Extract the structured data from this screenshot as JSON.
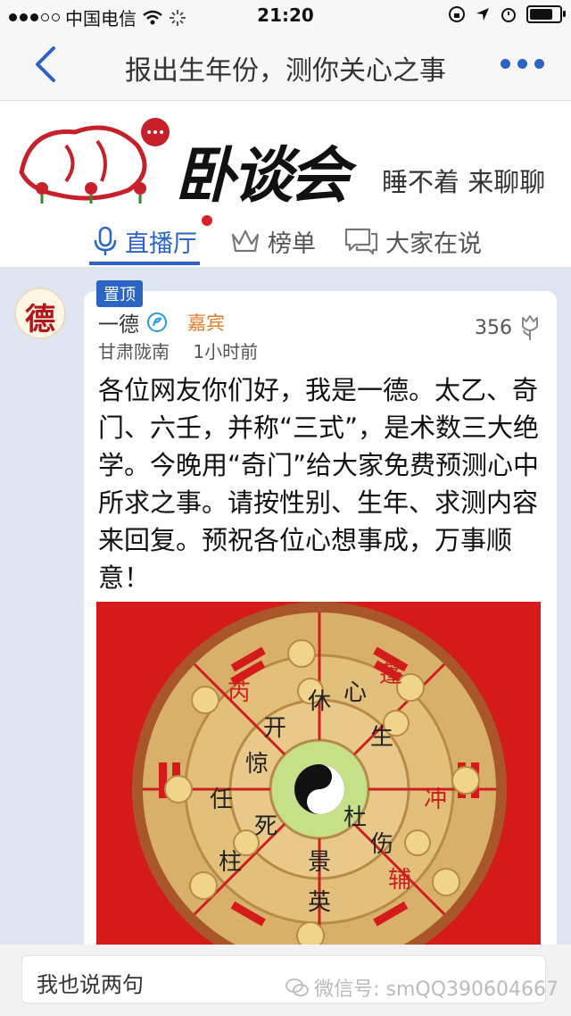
{
  "status_bar": {
    "carrier": "中国电信",
    "time": "21:20"
  },
  "nav": {
    "title": "报出生年份，测你关心之事"
  },
  "banner": {
    "logo_text": "卧谈会",
    "slogan": "睡不着 来聊聊"
  },
  "tabs": [
    {
      "label": "直播厅",
      "icon": "microphone-icon",
      "active": true
    },
    {
      "label": "榜单",
      "icon": "crown-icon",
      "active": false
    },
    {
      "label": "大家在说",
      "icon": "chat-bubbles-icon",
      "active": false
    }
  ],
  "post": {
    "pinned_label": "置顶",
    "avatar_char": "德",
    "author": "一德",
    "role": "嘉宾",
    "location": "甘肃陇南",
    "time_ago": "1小时前",
    "likes": "356",
    "body": "各位网友你们好，我是一德。太乙、奇门、六壬，并称“三式”，是术数三大绝学。今晚用“奇门”给大家免费预测心中所求之事。请按性别、生年、求测内容来回复。预祝各位心想事成，万事顺意！",
    "photo_chars": [
      "休",
      "生",
      "伤",
      "杜",
      "景",
      "死",
      "惊",
      "开",
      "英",
      "辅",
      "冲",
      "任",
      "柱",
      "心",
      "蓬",
      "芮"
    ]
  },
  "composer": {
    "placeholder": "我也说两句"
  },
  "watermark": "微信号: smQQ390604667",
  "colors": {
    "accent": "#2a64c5",
    "guest": "#e07b2a",
    "badge_dot": "#d9212a",
    "photo_bg": "#d41a1a"
  }
}
